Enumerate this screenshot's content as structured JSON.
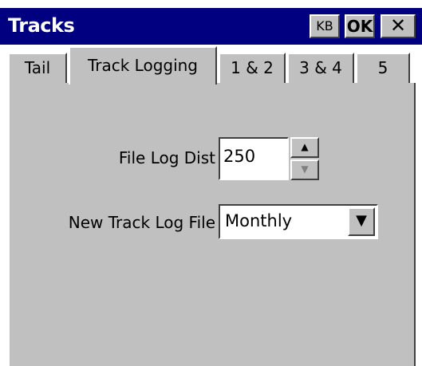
{
  "window": {
    "title": "Tracks"
  },
  "titlebar": {
    "kb_label": "KB",
    "ok_label": "OK",
    "close_label": "✕"
  },
  "tabs": [
    {
      "label": "Tail",
      "active": false
    },
    {
      "label": "Track Logging",
      "active": true
    },
    {
      "label": "1 & 2",
      "active": false
    },
    {
      "label": "3 & 4",
      "active": false
    },
    {
      "label": "5",
      "active": false
    }
  ],
  "form": {
    "file_log_dist": {
      "label": "File Log Dist",
      "value": "250"
    },
    "new_track_log_file": {
      "label": "New Track Log File",
      "value": "Monthly"
    }
  },
  "icons": {
    "spin_up": "▲",
    "spin_down": "▼",
    "dropdown": "▼"
  },
  "colors": {
    "titlebar": "#000080",
    "face": "#c0c0c0"
  }
}
